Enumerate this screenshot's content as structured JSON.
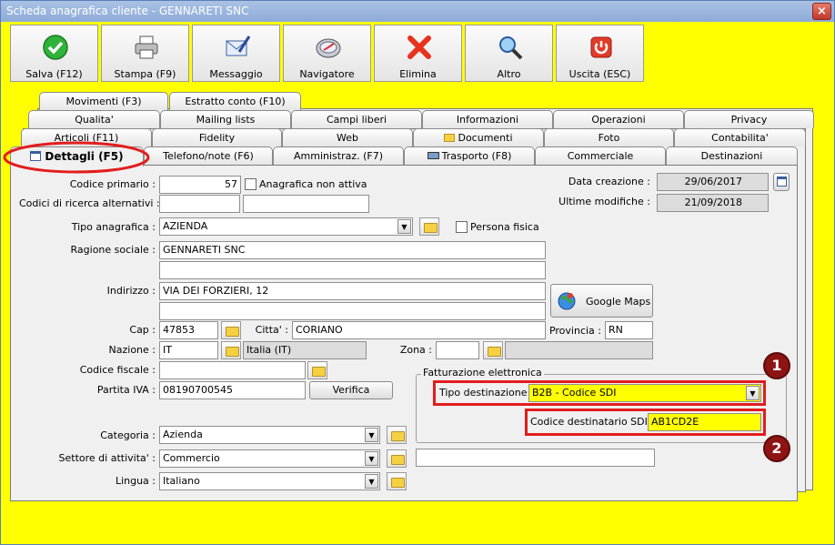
{
  "window": {
    "title": "Scheda anagrafica cliente - GENNARETI SNC",
    "close": "×"
  },
  "toolbar": [
    {
      "label": "Salva (F12)",
      "icon": "check-icon"
    },
    {
      "label": "Stampa (F9)",
      "icon": "printer-icon"
    },
    {
      "label": "Messaggio",
      "icon": "message-icon"
    },
    {
      "label": "Navigatore",
      "icon": "compass-icon"
    },
    {
      "label": "Elimina",
      "icon": "delete-icon"
    },
    {
      "label": "Altro",
      "icon": "search-icon"
    },
    {
      "label": "Uscita (ESC)",
      "icon": "power-icon"
    }
  ],
  "tabs": {
    "row1": [
      "Movimenti (F3)",
      "Estratto conto (F10)"
    ],
    "row2": [
      "Qualita'",
      "Mailing lists",
      "Campi liberi",
      "Informazioni",
      "Operazioni",
      "Privacy"
    ],
    "row3": [
      "Articoli (F11)",
      "Fidelity",
      "Web",
      "Documenti",
      "Foto",
      "Contabilita'"
    ],
    "row4": [
      "Dettagli (F5)",
      "Telefono/note (F6)",
      "Amministraz. (F7)",
      "Trasporto (F8)",
      "Commerciale",
      "Destinazioni"
    ]
  },
  "form": {
    "codice_primario_label": "Codice primario :",
    "codice_primario": "57",
    "anagrafica_non_attiva": "Anagrafica non attiva",
    "data_creazione_label": "Data creazione :",
    "data_creazione": "29/06/2017",
    "ultime_modifiche_label": "Ultime modifiche :",
    "ultime_modifiche": "21/09/2018",
    "codici_ricerca_label": "Codici di ricerca alternativi :",
    "codici_ricerca_1": "",
    "codici_ricerca_2": "",
    "tipo_anagrafica_label": "Tipo anagrafica :",
    "tipo_anagrafica": "AZIENDA",
    "persona_fisica": "Persona fisica",
    "ragione_sociale_label": "Ragione sociale :",
    "ragione_sociale": "GENNARETI SNC",
    "ragione_sociale_2": "",
    "indirizzo_label": "Indirizzo :",
    "indirizzo": "VIA DEI FORZIERI, 12",
    "indirizzo_2": "",
    "google_maps": "Google Maps",
    "cap_label": "Cap :",
    "cap": "47853",
    "citta_label": "Citta' :",
    "citta": "CORIANO",
    "provincia_label": "Provincia :",
    "provincia": "RN",
    "nazione_label": "Nazione :",
    "nazione": "IT",
    "nazione_desc": "Italia (IT)",
    "zona_label": "Zona :",
    "zona": "",
    "zona_desc": "",
    "codice_fiscale_label": "Codice fiscale :",
    "codice_fiscale": "",
    "partita_iva_label": "Partita IVA :",
    "partita_iva": "08190700545",
    "verifica": "Verifica",
    "fatturazione_title": "Fatturazione elettronica",
    "tipo_destinazione_label": "Tipo destinazione :",
    "tipo_destinazione": "B2B - Codice SDI",
    "codice_sdi_label": "Codice destinatario SDI :",
    "codice_sdi": "AB1CD2E",
    "categoria_label": "Categoria :",
    "categoria": "Azienda",
    "settore_label": "Settore di attivita' :",
    "settore": "Commercio",
    "settore_extra": "",
    "lingua_label": "Lingua :",
    "lingua": "Italiano"
  },
  "badges": [
    "1",
    "2"
  ],
  "colors": {
    "background": "#ffff00",
    "highlight": "#ffff00",
    "annotation": "#e21d1d",
    "badge": "#8e1414"
  }
}
